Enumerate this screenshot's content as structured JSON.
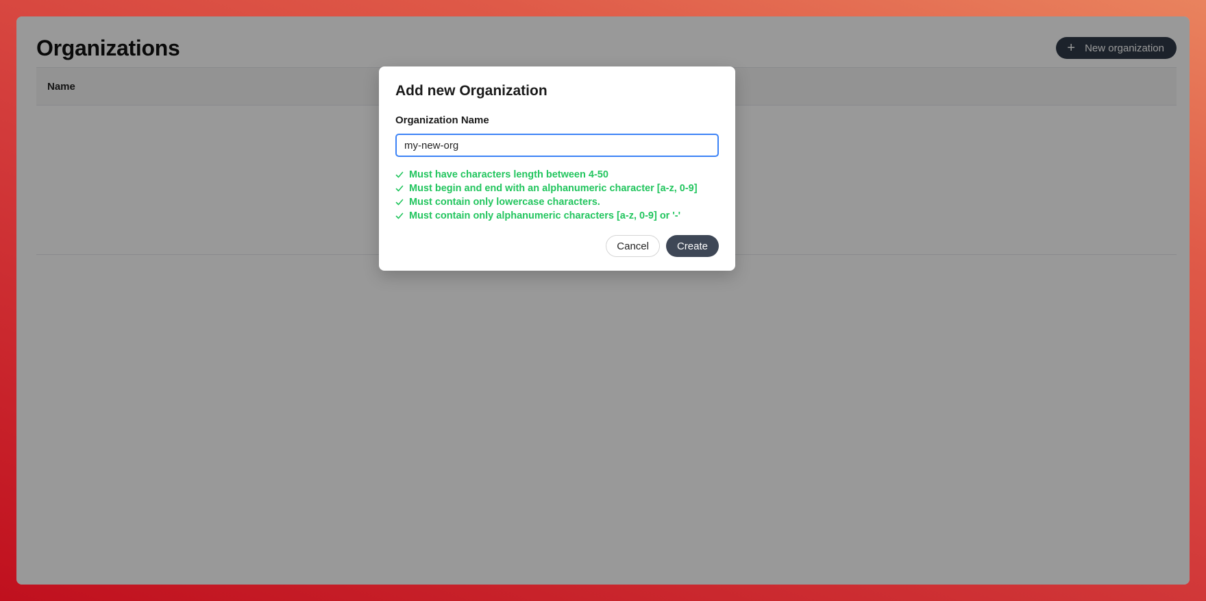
{
  "page": {
    "title": "Organizations",
    "new_button_label": "New organization"
  },
  "table": {
    "columns": [
      "Name"
    ]
  },
  "modal": {
    "title": "Add new Organization",
    "field_label": "Organization Name",
    "field_value": "my-new-org",
    "rules": [
      "Must have characters length between 4-50",
      "Must begin and end with an alphanumeric character [a-z, 0-9]",
      "Must contain only lowercase characters.",
      "Must contain only alphanumeric characters [a-z, 0-9] or '-'"
    ],
    "cancel_label": "Cancel",
    "create_label": "Create"
  },
  "colors": {
    "rule_valid": "#22c55e",
    "primary_button": "#3e4756",
    "input_focus": "#3b82f6"
  },
  "icons": {
    "new_button": "plus-icon",
    "rule_status": "check-icon"
  }
}
